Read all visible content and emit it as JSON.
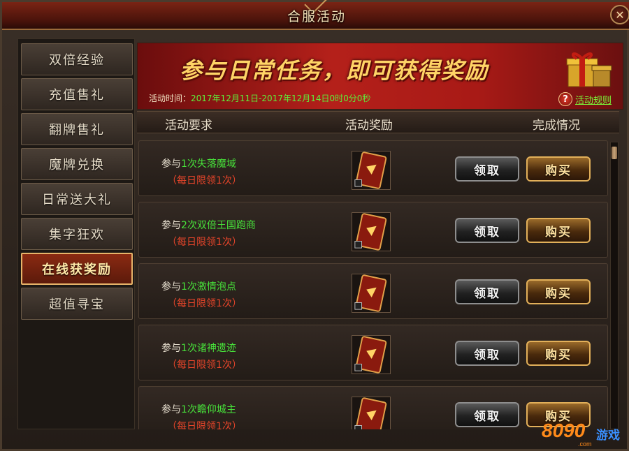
{
  "window": {
    "title": "合服活动",
    "close_label": "✕"
  },
  "sidebar": {
    "items": [
      {
        "label": "双倍经验"
      },
      {
        "label": "充值售礼"
      },
      {
        "label": "翻牌售礼"
      },
      {
        "label": "魔牌兑换"
      },
      {
        "label": "日常送大礼"
      },
      {
        "label": "集字狂欢"
      },
      {
        "label": "在线获奖励",
        "active": true
      },
      {
        "label": "超值寻宝"
      }
    ]
  },
  "banner": {
    "headline": "参与日常任务，即可获得奖励",
    "time_label": "活动时间：",
    "time_value": "2017年12月11日-2017年12月14日0时0分0秒",
    "rules_link": "活动规则",
    "rules_icon": "question-icon"
  },
  "table": {
    "headers": {
      "requirement": "活动要求",
      "reward": "活动奖励",
      "status": "完成情况"
    },
    "rows": [
      {
        "prefix": "参与",
        "task": "1次失落魔域",
        "limit": "（每日限领1次）",
        "claim_label": "领取",
        "buy_label": "购买"
      },
      {
        "prefix": "参与",
        "task": "2次双倍王国跑商",
        "limit": "（每日限领1次）",
        "claim_label": "领取",
        "buy_label": "购买"
      },
      {
        "prefix": "参与",
        "task": "1次激情泡点",
        "limit": "（每日限领1次）",
        "claim_label": "领取",
        "buy_label": "购买"
      },
      {
        "prefix": "参与",
        "task": "1次诸神遗迹",
        "limit": "（每日限领1次）",
        "claim_label": "领取",
        "buy_label": "购买"
      },
      {
        "prefix": "参与",
        "task": "1次瞻仰城主",
        "limit": "（每日限领1次）",
        "claim_label": "领取",
        "buy_label": "购买"
      }
    ]
  },
  "watermark": {
    "number": "8090",
    "name": "游戏",
    "domain": ".com"
  },
  "colors": {
    "accent_green": "#47e03a",
    "limit_red": "#e8452a",
    "banner_red": "#b4201a",
    "headline_gold": "#ffd466"
  }
}
